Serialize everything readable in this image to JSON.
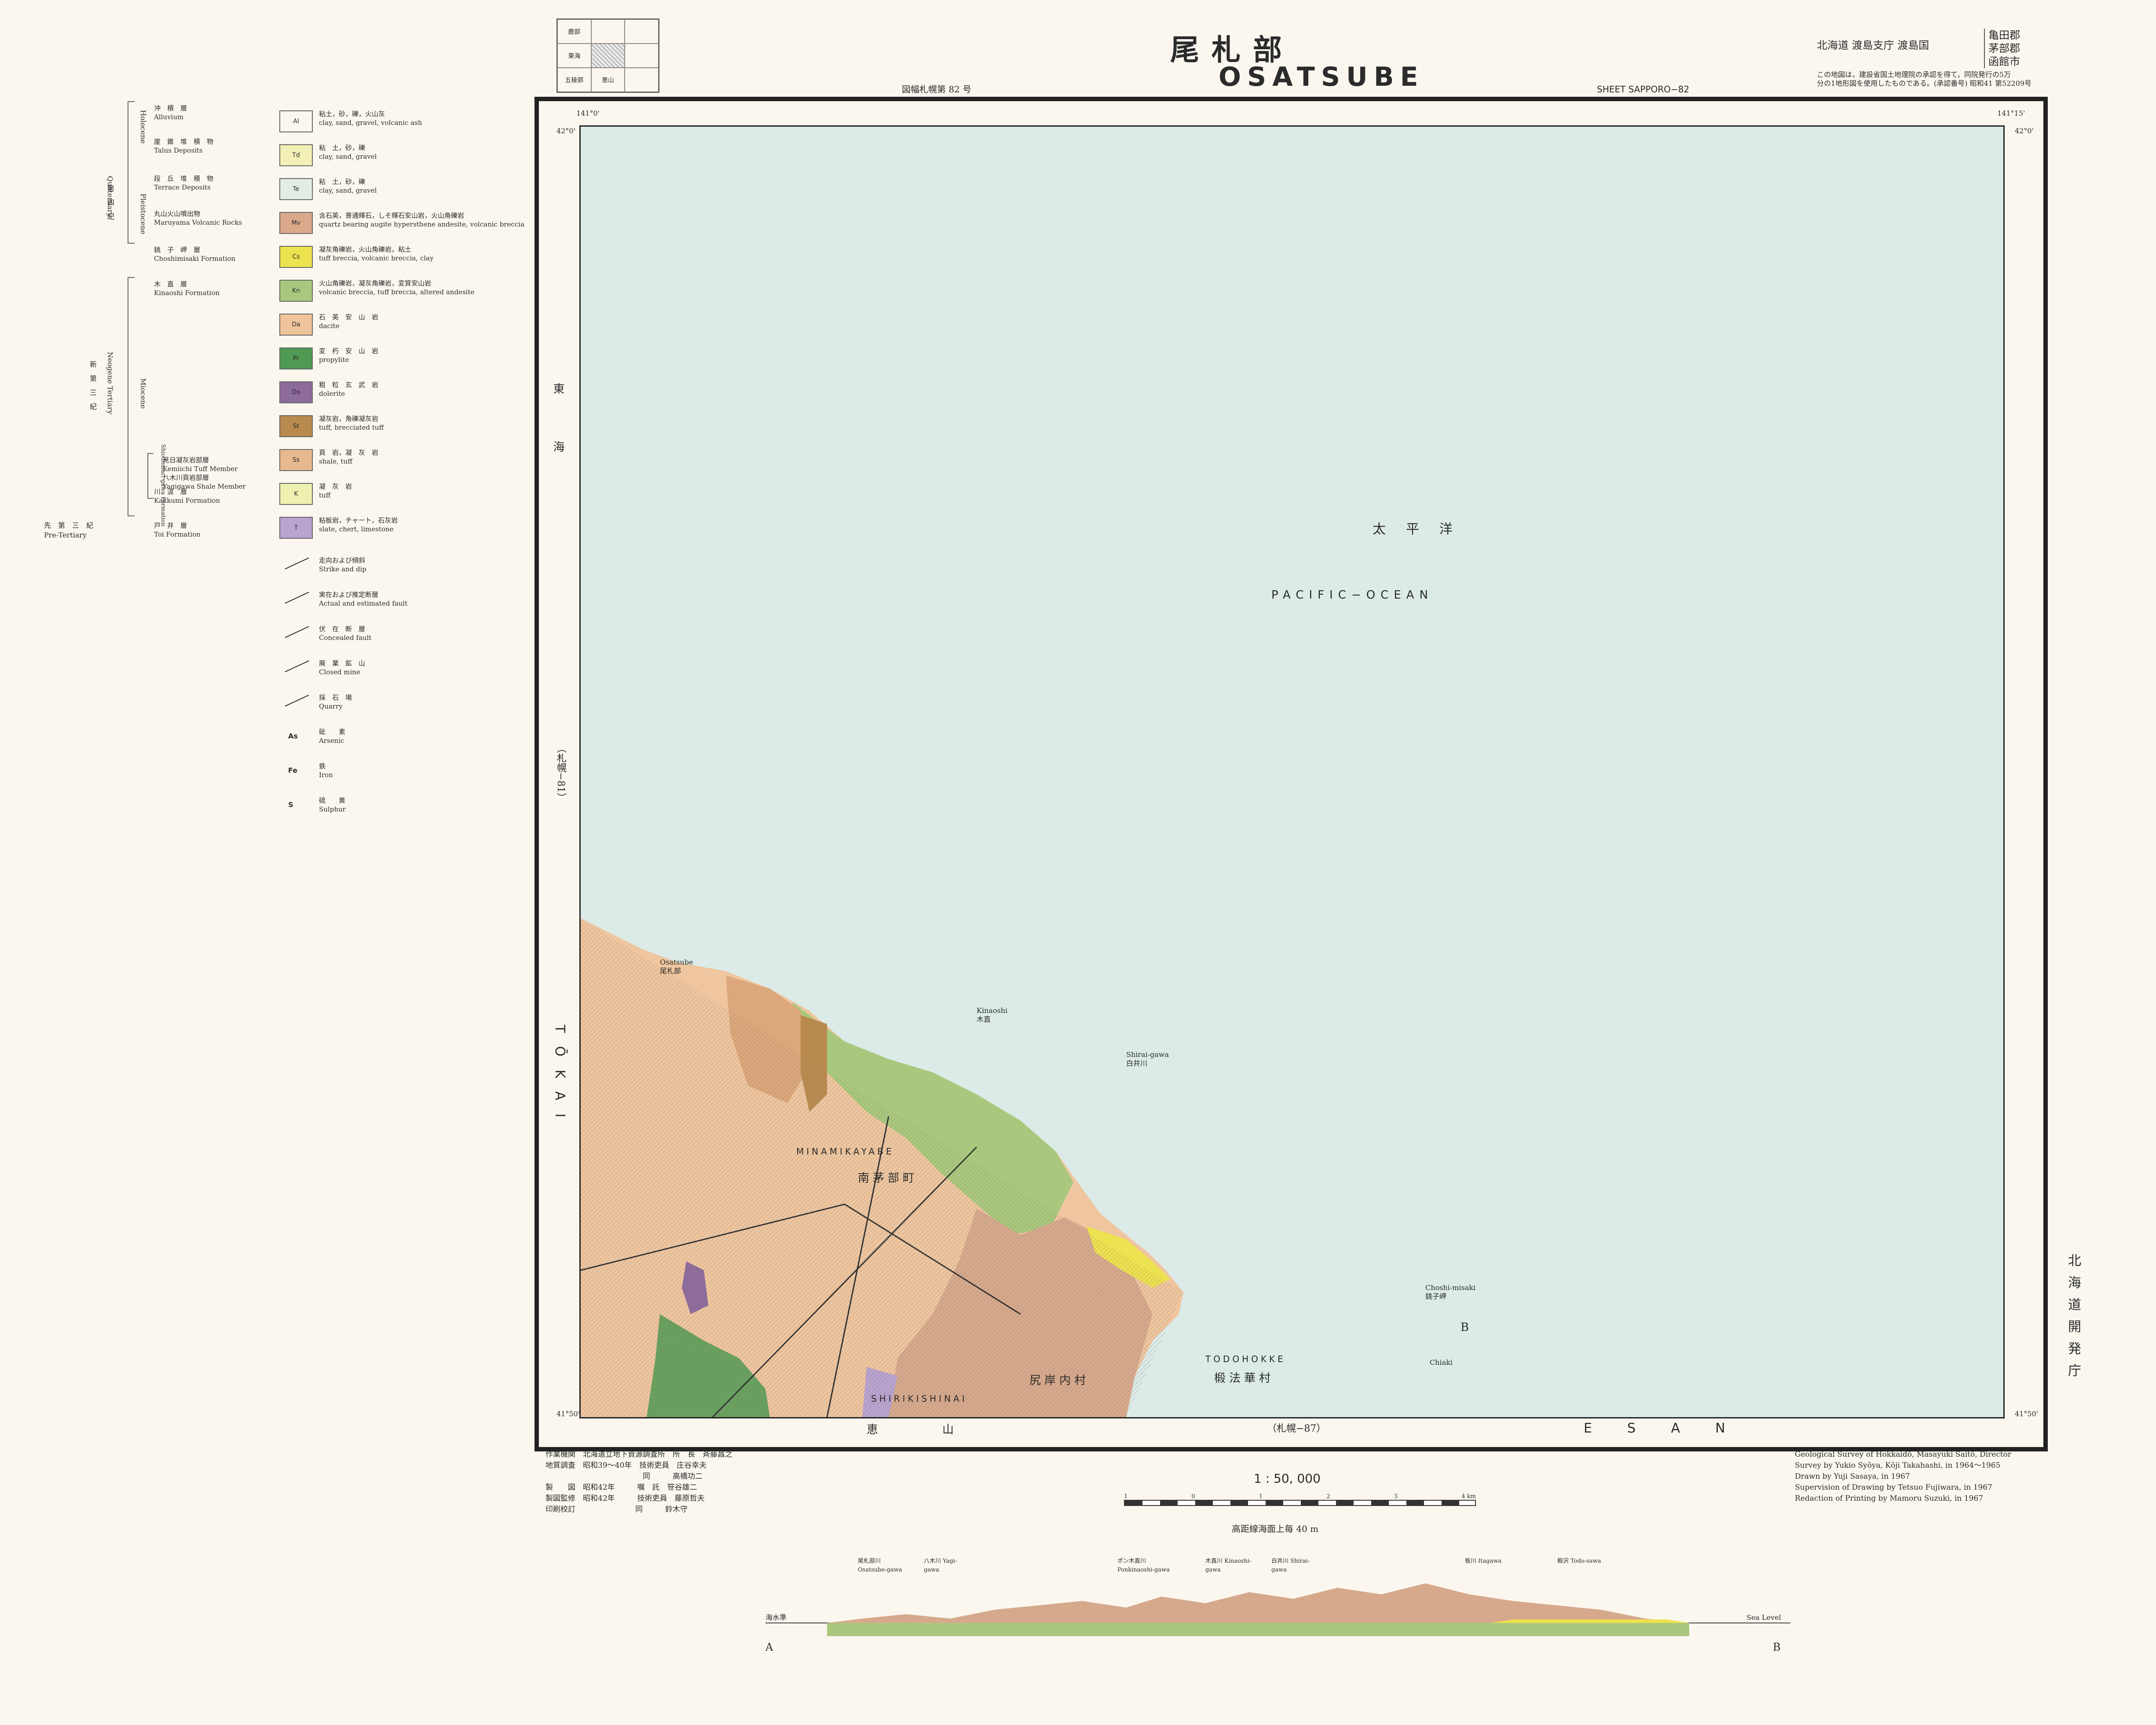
{
  "header": {
    "title_jp": "尾札部",
    "title_en": "OSATSUBE",
    "series_jp": "図幅札幌第 82 号",
    "sheet": "SHEET SAPPORO−82",
    "region": "北海道 渡島支庁 渡島国",
    "districts": [
      "亀田郡",
      "茅部郡",
      "函館市"
    ],
    "note_line1": "この地図は，建設省国土地理院の承認を得て，同院発行の5万",
    "note_line2": "分の1地形図を使用したものである。(承認番号) 昭和41 第52209号"
  },
  "index_map": [
    "鹿部",
    "",
    "",
    "東海",
    "",
    "",
    "五稜郭",
    "恵山",
    ""
  ],
  "map": {
    "sea_jp": "太　平　洋",
    "sea_en": "PACIFIC−OCEAN",
    "left_edge_jp": "東　海",
    "left_edge_sheet": "（札幌−81）",
    "left_edge_en": "TŌKAI",
    "bottom_edge_jp": "恵　山",
    "bottom_edge_sheet": "（札幌−87）",
    "bottom_edge_en": "ESAN",
    "places": [
      {
        "jp": "南茅部町",
        "en": "MINAMIKAYABE"
      },
      {
        "jp": "椴法華村",
        "en": "TODOHOKKE"
      },
      {
        "jp": "尻岸内村",
        "en": "SHIRIKISHINAI"
      },
      {
        "jp": "尾札部",
        "en": "Osatsube"
      },
      {
        "jp": "木直",
        "en": "Kinaoshi"
      },
      {
        "jp": "白井川",
        "en": "Shirai-gawa"
      },
      {
        "jp": "銚子岬",
        "en": "Choshi-misaki"
      },
      {
        "jp": "",
        "en": "Chiaki"
      }
    ],
    "corners": [
      "141°0'",
      "141°15'",
      "42°0'",
      "41°50'"
    ],
    "section_labels": [
      "A",
      "B"
    ]
  },
  "stratigraphy": [
    {
      "jp": "沖　積　層",
      "en": "Alluvium"
    },
    {
      "jp": "崖　錐　堆　積　物",
      "en": "Talus Deposits"
    },
    {
      "jp": "段　丘　堆　積　物",
      "en": "Terrace Deposits"
    },
    {
      "jp": "丸山火山噴出物",
      "en": "Maruyama Volcanic Rocks"
    },
    {
      "jp": "銚　子　岬　層",
      "en": "Choshimisaki Formation"
    },
    {
      "jp": "木　直　層",
      "en": "Kinaoshi Formation"
    },
    {
      "jp": "見日凝灰岩部層",
      "en": "Kemiichi Tuff Member"
    },
    {
      "jp": "八木川頁岩部層",
      "en": "Yagigawa Shale Member"
    },
    {
      "jp": "川　汲　層",
      "en": "Kakkumi Formation"
    },
    {
      "jp": "戸　井　層",
      "en": "Toi Formation"
    }
  ],
  "era_labels": [
    "第　四　紀",
    "Quaternary",
    "Holocene",
    "Pleistocene",
    "新　第　三　紀",
    "Neogene Tertiary",
    "Miocene",
    "Shiodomari gawa Formation",
    "先　第　三　紀",
    "Pre-Tertiary"
  ],
  "legend": [
    {
      "code": "Al",
      "color": "#fbf7ef",
      "jp": "粘土，砂，礫，火山灰",
      "en": "clay, sand, gravel, volcanic ash"
    },
    {
      "code": "Td",
      "color": "#f3f0b6",
      "jp": "粘　土，砂，礫",
      "en": "clay, sand, gravel"
    },
    {
      "code": "Te",
      "color": "#e2eee4",
      "jp": "粘　土，砂，礫",
      "en": "clay, sand, gravel"
    },
    {
      "code": "Mv",
      "color": "#d9a98a",
      "jp": "含石英，普通輝石，しそ輝石安山岩，火山角礫岩",
      "en": "quartz bearing augite hypersthene andesite, volcanic breccia"
    },
    {
      "code": "Cs",
      "color": "#ede24f",
      "jp": "凝灰角礫岩，火山角礫岩，粘土",
      "en": "tuff breccia, volcanic breccia, clay"
    },
    {
      "code": "Kn",
      "color": "#a9c87d",
      "jp": "火山角礫岩，凝灰角礫岩，変質安山岩",
      "en": "volcanic breccia, tuff breccia, altered andesite"
    },
    {
      "code": "Da",
      "color": "#f0c49a",
      "jp": "石　英　安　山　岩",
      "en": "dacite"
    },
    {
      "code": "Pr",
      "color": "#4f9a52",
      "jp": "変　朽　安　山　岩",
      "en": "propylite"
    },
    {
      "code": "Do",
      "color": "#8d6b9d",
      "jp": "粗　粒　玄　武　岩",
      "en": "dolerite"
    },
    {
      "code": "St",
      "color": "#b98a4e",
      "jp": "凝灰岩，角礫凝灰岩",
      "en": "tuff, brecciated tuff"
    },
    {
      "code": "Ss",
      "color": "#e8b98f",
      "jp": "頁　岩，凝　灰　岩",
      "en": "shale, tuff"
    },
    {
      "code": "K",
      "color": "#eef0b0",
      "jp": "凝　灰　岩",
      "en": "tuff"
    },
    {
      "code": "T",
      "color": "#b9a3d1",
      "jp": "粘板岩，チャート，石灰岩",
      "en": "slate, chert, limestone"
    }
  ],
  "symbols": [
    {
      "jp": "走向および傾斜",
      "en": "Strike and dip"
    },
    {
      "jp": "実在および推定断層",
      "en": "Actual and estimated fault"
    },
    {
      "jp": "伏　在　断　層",
      "en": "Concealed fault"
    },
    {
      "jp": "廃　業　鉱　山",
      "en": "Closed mine"
    },
    {
      "jp": "採　石　場",
      "en": "Quarry"
    },
    {
      "code": "As",
      "jp": "砒　　素",
      "en": "Arsenic"
    },
    {
      "code": "Fe",
      "jp": "鉄",
      "en": "Iron"
    },
    {
      "code": "S",
      "jp": "硫　　黄",
      "en": "Sulphur"
    }
  ],
  "credits_jp": [
    "作業機関　北海道立地下資源調査所　所　長　斉藤昌之",
    "地質調査　昭和39〜40年　技術吏員　庄谷幸夫",
    "　　　　　　　　　　　　　同　　　高橋功二",
    "製　　図　昭和42年　　　嘱　託　笹谷雄二",
    "製図監修　昭和42年　　　技術吏員　藤原哲夫",
    "印刷校訂　　　　　　　　同　　　鈴木守"
  ],
  "credits_en": [
    "Geological Survey of Hokkaidō, Masayuki Saitō, Director",
    "Survey by Yukio Syōya, Kōji Takahashi, in 1964〜1965",
    "Drawn by Yuji Sasaya, in 1967",
    "Supervision of Drawing by Tetsuo Fujiwara, in 1967",
    "Redaction of Printing by Mamoru Suzuki, in 1967"
  ],
  "scale": {
    "label": "1 : 50, 000",
    "contour": "高距線海面上毎 40 m",
    "ticks": [
      "1",
      "0",
      "1",
      "2",
      "3",
      "4 km"
    ]
  },
  "publisher": "北海道開発庁",
  "section": {
    "sea_level_jp": "海水準",
    "sea_level_en": "Sea Level",
    "rivers": [
      "尾札部川 Osatsube-gawa",
      "八木川 Yagi-gawa",
      "ポン木直川 Ponkinaoshi-gawa",
      "木直川 Kinaoshi-gawa",
      "白井川 Shirai-gawa",
      "板川 Itagawa",
      "椴沢 Todo-sawa"
    ]
  },
  "colors": {
    "sea": "#dcebe7",
    "frame": "#222222",
    "paper": "#fbf7ef"
  }
}
